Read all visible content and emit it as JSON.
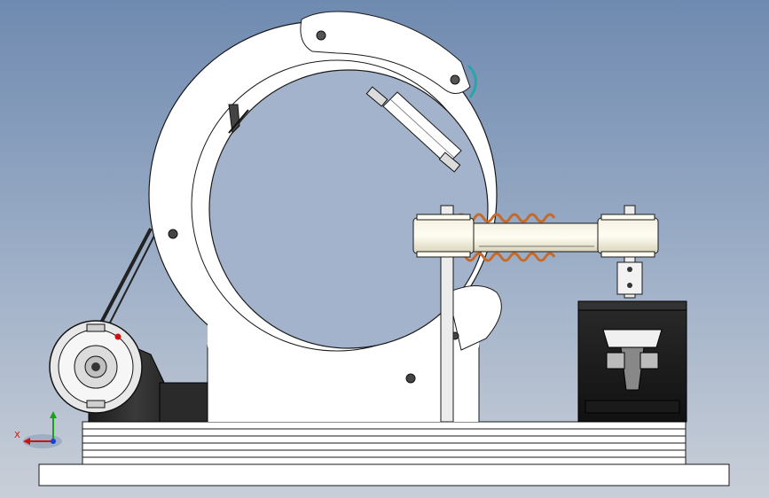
{
  "viewport": {
    "background_top": "#6f8ab0",
    "background_bottom": "#c9cfd8"
  },
  "model": {
    "part_stroke": "#1a1a1a",
    "part_fill": "#ffffff",
    "copper_color": "#c46a2a",
    "motor_fill": "#2b2b2b",
    "accent_teal": "#2aa6a6"
  },
  "triad": {
    "x_label": "X",
    "x_color": "#d01010",
    "y_color": "#18a018",
    "z_color": "#1f3fd0"
  }
}
